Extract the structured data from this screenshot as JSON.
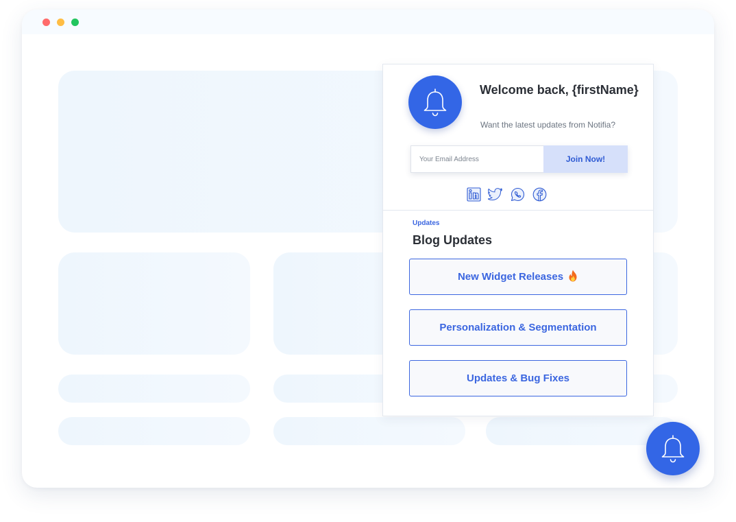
{
  "window": {
    "controls": [
      "close",
      "minimize",
      "maximize"
    ]
  },
  "widget": {
    "welcome_title": "Welcome back, {firstName}",
    "tagline": "Want the latest updates from Notifia?",
    "email_placeholder": "Your Email Address",
    "join_label": "Join Now!",
    "social_icons": [
      "linkedin-icon",
      "twitter-icon",
      "whatsapp-icon",
      "facebook-icon"
    ],
    "section_label": "Updates",
    "section_title": "Blog Updates",
    "blog_items": [
      {
        "label": "New Widget Releases",
        "icon": "fire-emoji-icon"
      },
      {
        "label": "Personalization & Segmentation"
      },
      {
        "label": "Updates & Bug Fixes"
      }
    ]
  },
  "colors": {
    "accent": "#3366e6",
    "join_button_bg": "#d6e0fa",
    "placeholder_bg": "#eef6fd"
  },
  "fab": {
    "icon": "bell-icon"
  }
}
